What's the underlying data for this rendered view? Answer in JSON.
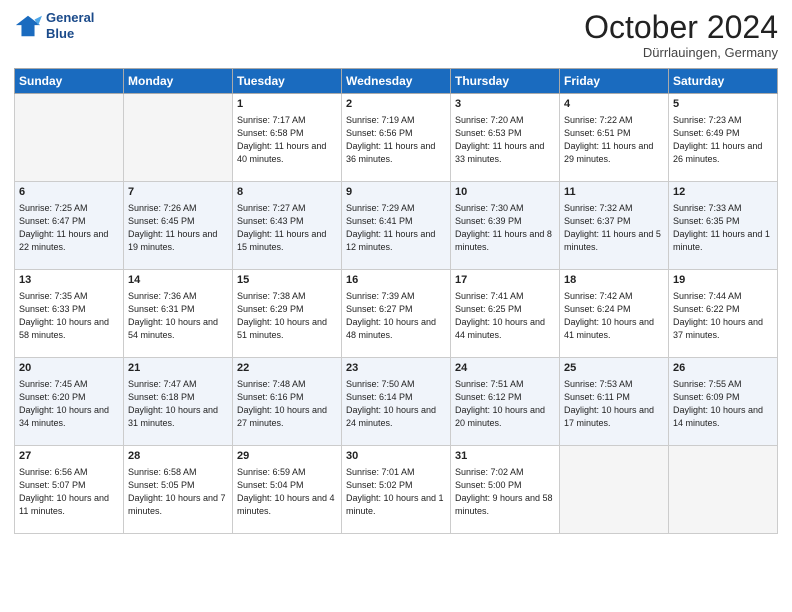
{
  "header": {
    "logo_line1": "General",
    "logo_line2": "Blue",
    "month": "October 2024",
    "location": "Dürrlauingen, Germany"
  },
  "days_of_week": [
    "Sunday",
    "Monday",
    "Tuesday",
    "Wednesday",
    "Thursday",
    "Friday",
    "Saturday"
  ],
  "weeks": [
    [
      {
        "num": "",
        "detail": ""
      },
      {
        "num": "",
        "detail": ""
      },
      {
        "num": "1",
        "detail": "Sunrise: 7:17 AM\nSunset: 6:58 PM\nDaylight: 11 hours and 40 minutes."
      },
      {
        "num": "2",
        "detail": "Sunrise: 7:19 AM\nSunset: 6:56 PM\nDaylight: 11 hours and 36 minutes."
      },
      {
        "num": "3",
        "detail": "Sunrise: 7:20 AM\nSunset: 6:53 PM\nDaylight: 11 hours and 33 minutes."
      },
      {
        "num": "4",
        "detail": "Sunrise: 7:22 AM\nSunset: 6:51 PM\nDaylight: 11 hours and 29 minutes."
      },
      {
        "num": "5",
        "detail": "Sunrise: 7:23 AM\nSunset: 6:49 PM\nDaylight: 11 hours and 26 minutes."
      }
    ],
    [
      {
        "num": "6",
        "detail": "Sunrise: 7:25 AM\nSunset: 6:47 PM\nDaylight: 11 hours and 22 minutes."
      },
      {
        "num": "7",
        "detail": "Sunrise: 7:26 AM\nSunset: 6:45 PM\nDaylight: 11 hours and 19 minutes."
      },
      {
        "num": "8",
        "detail": "Sunrise: 7:27 AM\nSunset: 6:43 PM\nDaylight: 11 hours and 15 minutes."
      },
      {
        "num": "9",
        "detail": "Sunrise: 7:29 AM\nSunset: 6:41 PM\nDaylight: 11 hours and 12 minutes."
      },
      {
        "num": "10",
        "detail": "Sunrise: 7:30 AM\nSunset: 6:39 PM\nDaylight: 11 hours and 8 minutes."
      },
      {
        "num": "11",
        "detail": "Sunrise: 7:32 AM\nSunset: 6:37 PM\nDaylight: 11 hours and 5 minutes."
      },
      {
        "num": "12",
        "detail": "Sunrise: 7:33 AM\nSunset: 6:35 PM\nDaylight: 11 hours and 1 minute."
      }
    ],
    [
      {
        "num": "13",
        "detail": "Sunrise: 7:35 AM\nSunset: 6:33 PM\nDaylight: 10 hours and 58 minutes."
      },
      {
        "num": "14",
        "detail": "Sunrise: 7:36 AM\nSunset: 6:31 PM\nDaylight: 10 hours and 54 minutes."
      },
      {
        "num": "15",
        "detail": "Sunrise: 7:38 AM\nSunset: 6:29 PM\nDaylight: 10 hours and 51 minutes."
      },
      {
        "num": "16",
        "detail": "Sunrise: 7:39 AM\nSunset: 6:27 PM\nDaylight: 10 hours and 48 minutes."
      },
      {
        "num": "17",
        "detail": "Sunrise: 7:41 AM\nSunset: 6:25 PM\nDaylight: 10 hours and 44 minutes."
      },
      {
        "num": "18",
        "detail": "Sunrise: 7:42 AM\nSunset: 6:24 PM\nDaylight: 10 hours and 41 minutes."
      },
      {
        "num": "19",
        "detail": "Sunrise: 7:44 AM\nSunset: 6:22 PM\nDaylight: 10 hours and 37 minutes."
      }
    ],
    [
      {
        "num": "20",
        "detail": "Sunrise: 7:45 AM\nSunset: 6:20 PM\nDaylight: 10 hours and 34 minutes."
      },
      {
        "num": "21",
        "detail": "Sunrise: 7:47 AM\nSunset: 6:18 PM\nDaylight: 10 hours and 31 minutes."
      },
      {
        "num": "22",
        "detail": "Sunrise: 7:48 AM\nSunset: 6:16 PM\nDaylight: 10 hours and 27 minutes."
      },
      {
        "num": "23",
        "detail": "Sunrise: 7:50 AM\nSunset: 6:14 PM\nDaylight: 10 hours and 24 minutes."
      },
      {
        "num": "24",
        "detail": "Sunrise: 7:51 AM\nSunset: 6:12 PM\nDaylight: 10 hours and 20 minutes."
      },
      {
        "num": "25",
        "detail": "Sunrise: 7:53 AM\nSunset: 6:11 PM\nDaylight: 10 hours and 17 minutes."
      },
      {
        "num": "26",
        "detail": "Sunrise: 7:55 AM\nSunset: 6:09 PM\nDaylight: 10 hours and 14 minutes."
      }
    ],
    [
      {
        "num": "27",
        "detail": "Sunrise: 6:56 AM\nSunset: 5:07 PM\nDaylight: 10 hours and 11 minutes."
      },
      {
        "num": "28",
        "detail": "Sunrise: 6:58 AM\nSunset: 5:05 PM\nDaylight: 10 hours and 7 minutes."
      },
      {
        "num": "29",
        "detail": "Sunrise: 6:59 AM\nSunset: 5:04 PM\nDaylight: 10 hours and 4 minutes."
      },
      {
        "num": "30",
        "detail": "Sunrise: 7:01 AM\nSunset: 5:02 PM\nDaylight: 10 hours and 1 minute."
      },
      {
        "num": "31",
        "detail": "Sunrise: 7:02 AM\nSunset: 5:00 PM\nDaylight: 9 hours and 58 minutes."
      },
      {
        "num": "",
        "detail": ""
      },
      {
        "num": "",
        "detail": ""
      }
    ]
  ]
}
